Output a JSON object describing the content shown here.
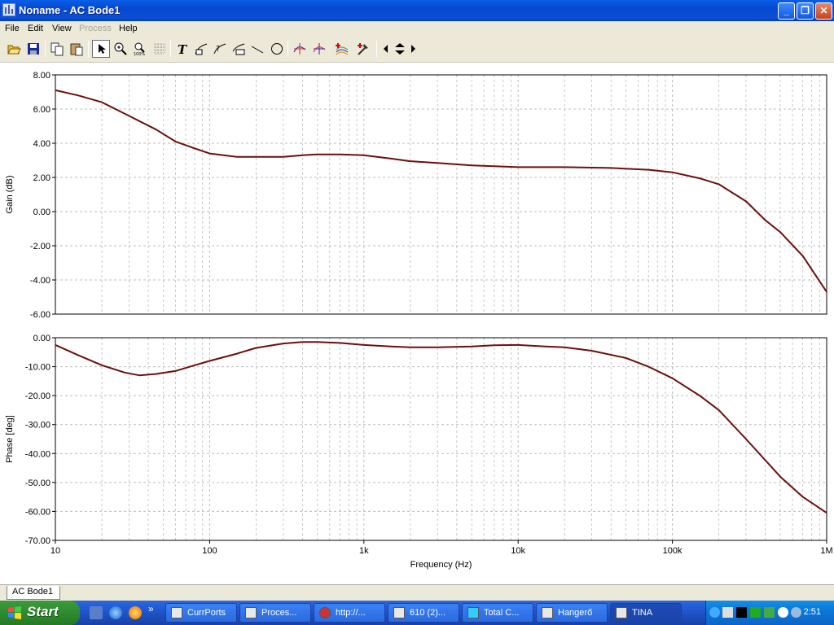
{
  "window": {
    "title": "Noname - AC Bode1",
    "min_label": "_",
    "max_label": "❐",
    "close_label": "✕"
  },
  "menu": {
    "items": [
      {
        "label": "File",
        "disabled": false
      },
      {
        "label": "Edit",
        "disabled": false
      },
      {
        "label": "View",
        "disabled": false
      },
      {
        "label": "Process",
        "disabled": true
      },
      {
        "label": "Help",
        "disabled": false
      }
    ]
  },
  "toolbar": {
    "tools": [
      "open-icon",
      "save-icon",
      "copy-icon",
      "paste-icon",
      "pointer-icon",
      "zoom-in-icon",
      "zoom-100-icon",
      "grid-icon",
      "text-icon",
      "label-curve-icon",
      "label-point-icon",
      "label-axis-icon",
      "line-icon",
      "circle-icon",
      "cursor-a-icon",
      "cursor-b-icon",
      "add-curve-icon",
      "pick-icon",
      "arrow-left-icon",
      "arrow-updown-icon",
      "arrow-right-icon"
    ]
  },
  "chart_data": [
    {
      "type": "line",
      "title": "",
      "xlabel": "Frequency (Hz)",
      "ylabel": "Gain (dB)",
      "xscale": "log",
      "xlim": [
        10,
        1000000
      ],
      "ylim": [
        -6,
        8
      ],
      "yticks": [
        "8.00",
        "6.00",
        "4.00",
        "2.00",
        "0.00",
        "-2.00",
        "-4.00",
        "-6.00"
      ],
      "xticks": [
        "10",
        "100",
        "1k",
        "10k",
        "100k",
        "1M"
      ],
      "grid": true,
      "color": "#6b0f0f",
      "series": [
        {
          "x": [
            10,
            14,
            20,
            30,
            45,
            60,
            80,
            100,
            150,
            200,
            300,
            400,
            500,
            700,
            1000,
            1500,
            2000,
            3000,
            5000,
            7000,
            10000,
            20000,
            40000,
            70000,
            100000,
            150000,
            200000,
            300000,
            400000,
            500000,
            700000,
            1000000
          ],
          "values": [
            7.1,
            6.8,
            6.4,
            5.6,
            4.8,
            4.1,
            3.7,
            3.4,
            3.2,
            3.2,
            3.2,
            3.3,
            3.35,
            3.35,
            3.3,
            3.1,
            2.95,
            2.85,
            2.7,
            2.65,
            2.6,
            2.6,
            2.55,
            2.45,
            2.3,
            1.95,
            1.6,
            0.6,
            -0.5,
            -1.2,
            -2.6,
            -4.7
          ]
        }
      ]
    },
    {
      "type": "line",
      "title": "",
      "xlabel": "Frequency (Hz)",
      "ylabel": "Phase [deg]",
      "xscale": "log",
      "xlim": [
        10,
        1000000
      ],
      "ylim": [
        -70,
        0
      ],
      "yticks": [
        "0.00",
        "-10.00",
        "-20.00",
        "-30.00",
        "-40.00",
        "-50.00",
        "-60.00",
        "-70.00"
      ],
      "xticks": [
        "10",
        "100",
        "1k",
        "10k",
        "100k",
        "1M"
      ],
      "grid": true,
      "color": "#6b0f0f",
      "series": [
        {
          "x": [
            10,
            14,
            20,
            28,
            35,
            45,
            60,
            80,
            100,
            150,
            200,
            300,
            400,
            500,
            700,
            1000,
            1500,
            2000,
            3000,
            5000,
            7000,
            10000,
            15000,
            20000,
            30000,
            50000,
            70000,
            100000,
            150000,
            200000,
            300000,
            500000,
            700000,
            1000000
          ],
          "values": [
            -2.5,
            -6,
            -9.5,
            -12,
            -13,
            -12.5,
            -11.5,
            -9.5,
            -8,
            -5.5,
            -3.5,
            -2,
            -1.5,
            -1.5,
            -1.8,
            -2.5,
            -3,
            -3.3,
            -3.3,
            -3,
            -2.6,
            -2.5,
            -3,
            -3.3,
            -4.5,
            -7,
            -10,
            -14,
            -20,
            -25,
            -35,
            -48,
            -55,
            -60.5
          ]
        }
      ]
    }
  ],
  "bottom_tab": "AC Bode1",
  "taskbar": {
    "start_label": "Start",
    "more_label": "»",
    "tasks": [
      {
        "label": "CurrPorts",
        "active": false
      },
      {
        "label": "Proces...",
        "active": false
      },
      {
        "label": "http://...",
        "active": false
      },
      {
        "label": "610 (2)...",
        "active": false
      },
      {
        "label": "Total C...",
        "active": false
      },
      {
        "label": "Hangerő",
        "active": false
      },
      {
        "label": "TINA",
        "active": true
      }
    ],
    "clock": "2:51"
  }
}
